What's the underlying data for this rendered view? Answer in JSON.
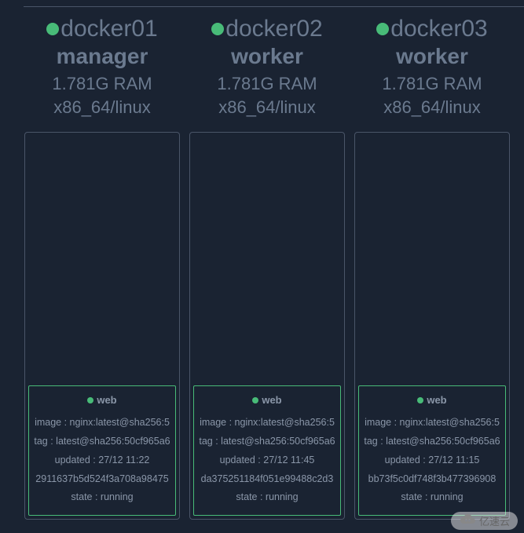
{
  "nodes": [
    {
      "name": "docker01",
      "role": "manager",
      "ram": "1.781G RAM",
      "arch": "x86_64/linux",
      "service": {
        "name": "web",
        "image": "image : nginx:latest@sha256:5",
        "tag": "tag : latest@sha256:50cf965a6",
        "updated": "updated : 27/12 11:22",
        "id": "2911637b5d524f3a708a98475",
        "state": "state : running"
      }
    },
    {
      "name": "docker02",
      "role": "worker",
      "ram": "1.781G RAM",
      "arch": "x86_64/linux",
      "service": {
        "name": "web",
        "image": "image : nginx:latest@sha256:5",
        "tag": "tag : latest@sha256:50cf965a6",
        "updated": "updated : 27/12 11:45",
        "id": "da375251184f051e99488c2d3",
        "state": "state : running"
      }
    },
    {
      "name": "docker03",
      "role": "worker",
      "ram": "1.781G RAM",
      "arch": "x86_64/linux",
      "service": {
        "name": "web",
        "image": "image : nginx:latest@sha256:5",
        "tag": "tag : latest@sha256:50cf965a6",
        "updated": "updated : 27/12 11:15",
        "id": "bb73f5c0df748f3b477396908",
        "state": "state : running"
      }
    }
  ],
  "watermark": "亿速云"
}
